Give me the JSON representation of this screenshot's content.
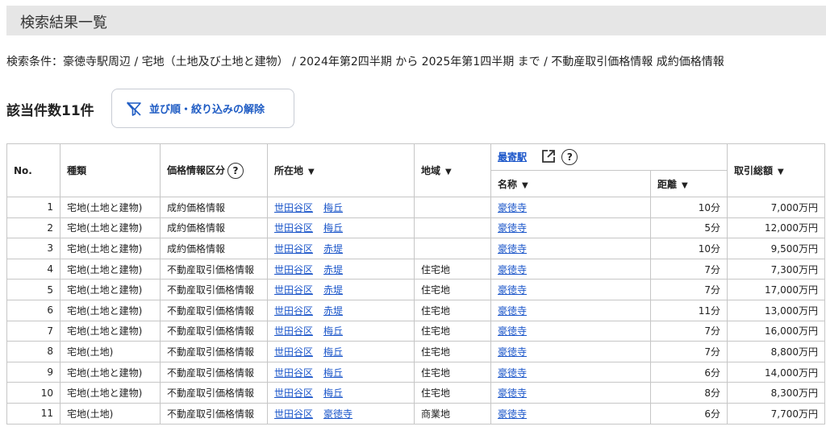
{
  "header": {
    "title": "検索結果一覧"
  },
  "conditions": "検索条件：豪徳寺駅周辺 / 宅地（土地及び土地と建物） / 2024年第2四半期 から 2025年第1四半期 まで / 不動産取引価格情報 成約価格情報",
  "count_label": "該当件数11件",
  "reset_button": {
    "label": "並び順・絞り込みの解除",
    "icon": "filter-off-icon"
  },
  "table": {
    "headers": {
      "no": "No.",
      "type": "種類",
      "price_class": "価格情報区分",
      "location": "所在地",
      "area": "地域",
      "station_group": "最寄駅",
      "station_name": "名称",
      "distance": "距離",
      "total_price": "取引総額"
    },
    "rows": [
      {
        "no": "1",
        "type": "宅地(土地と建物)",
        "price_class": "成約価格情報",
        "ward": "世田谷区",
        "town": "梅丘",
        "area": "",
        "station": "豪徳寺",
        "distance": "10分",
        "price": "7,000万円"
      },
      {
        "no": "2",
        "type": "宅地(土地と建物)",
        "price_class": "成約価格情報",
        "ward": "世田谷区",
        "town": "梅丘",
        "area": "",
        "station": "豪徳寺",
        "distance": "5分",
        "price": "12,000万円"
      },
      {
        "no": "3",
        "type": "宅地(土地と建物)",
        "price_class": "成約価格情報",
        "ward": "世田谷区",
        "town": "赤堤",
        "area": "",
        "station": "豪徳寺",
        "distance": "10分",
        "price": "9,500万円"
      },
      {
        "no": "4",
        "type": "宅地(土地と建物)",
        "price_class": "不動産取引価格情報",
        "ward": "世田谷区",
        "town": "赤堤",
        "area": "住宅地",
        "station": "豪徳寺",
        "distance": "7分",
        "price": "7,300万円"
      },
      {
        "no": "5",
        "type": "宅地(土地と建物)",
        "price_class": "不動産取引価格情報",
        "ward": "世田谷区",
        "town": "赤堤",
        "area": "住宅地",
        "station": "豪徳寺",
        "distance": "7分",
        "price": "17,000万円"
      },
      {
        "no": "6",
        "type": "宅地(土地と建物)",
        "price_class": "不動産取引価格情報",
        "ward": "世田谷区",
        "town": "赤堤",
        "area": "住宅地",
        "station": "豪徳寺",
        "distance": "11分",
        "price": "13,000万円"
      },
      {
        "no": "7",
        "type": "宅地(土地と建物)",
        "price_class": "不動産取引価格情報",
        "ward": "世田谷区",
        "town": "梅丘",
        "area": "住宅地",
        "station": "豪徳寺",
        "distance": "7分",
        "price": "16,000万円"
      },
      {
        "no": "8",
        "type": "宅地(土地)",
        "price_class": "不動産取引価格情報",
        "ward": "世田谷区",
        "town": "梅丘",
        "area": "住宅地",
        "station": "豪徳寺",
        "distance": "7分",
        "price": "8,800万円"
      },
      {
        "no": "9",
        "type": "宅地(土地と建物)",
        "price_class": "不動産取引価格情報",
        "ward": "世田谷区",
        "town": "梅丘",
        "area": "住宅地",
        "station": "豪徳寺",
        "distance": "6分",
        "price": "14,000万円"
      },
      {
        "no": "10",
        "type": "宅地(土地と建物)",
        "price_class": "不動産取引価格情報",
        "ward": "世田谷区",
        "town": "梅丘",
        "area": "住宅地",
        "station": "豪徳寺",
        "distance": "8分",
        "price": "8,300万円"
      },
      {
        "no": "11",
        "type": "宅地(土地)",
        "price_class": "不動産取引価格情報",
        "ward": "世田谷区",
        "town": "豪徳寺",
        "area": "商業地",
        "station": "豪徳寺",
        "distance": "6分",
        "price": "7,700万円"
      }
    ]
  },
  "colors": {
    "link": "#1a55c9",
    "header_bg": "#e6e6e6",
    "border": "#c6c6c6"
  }
}
